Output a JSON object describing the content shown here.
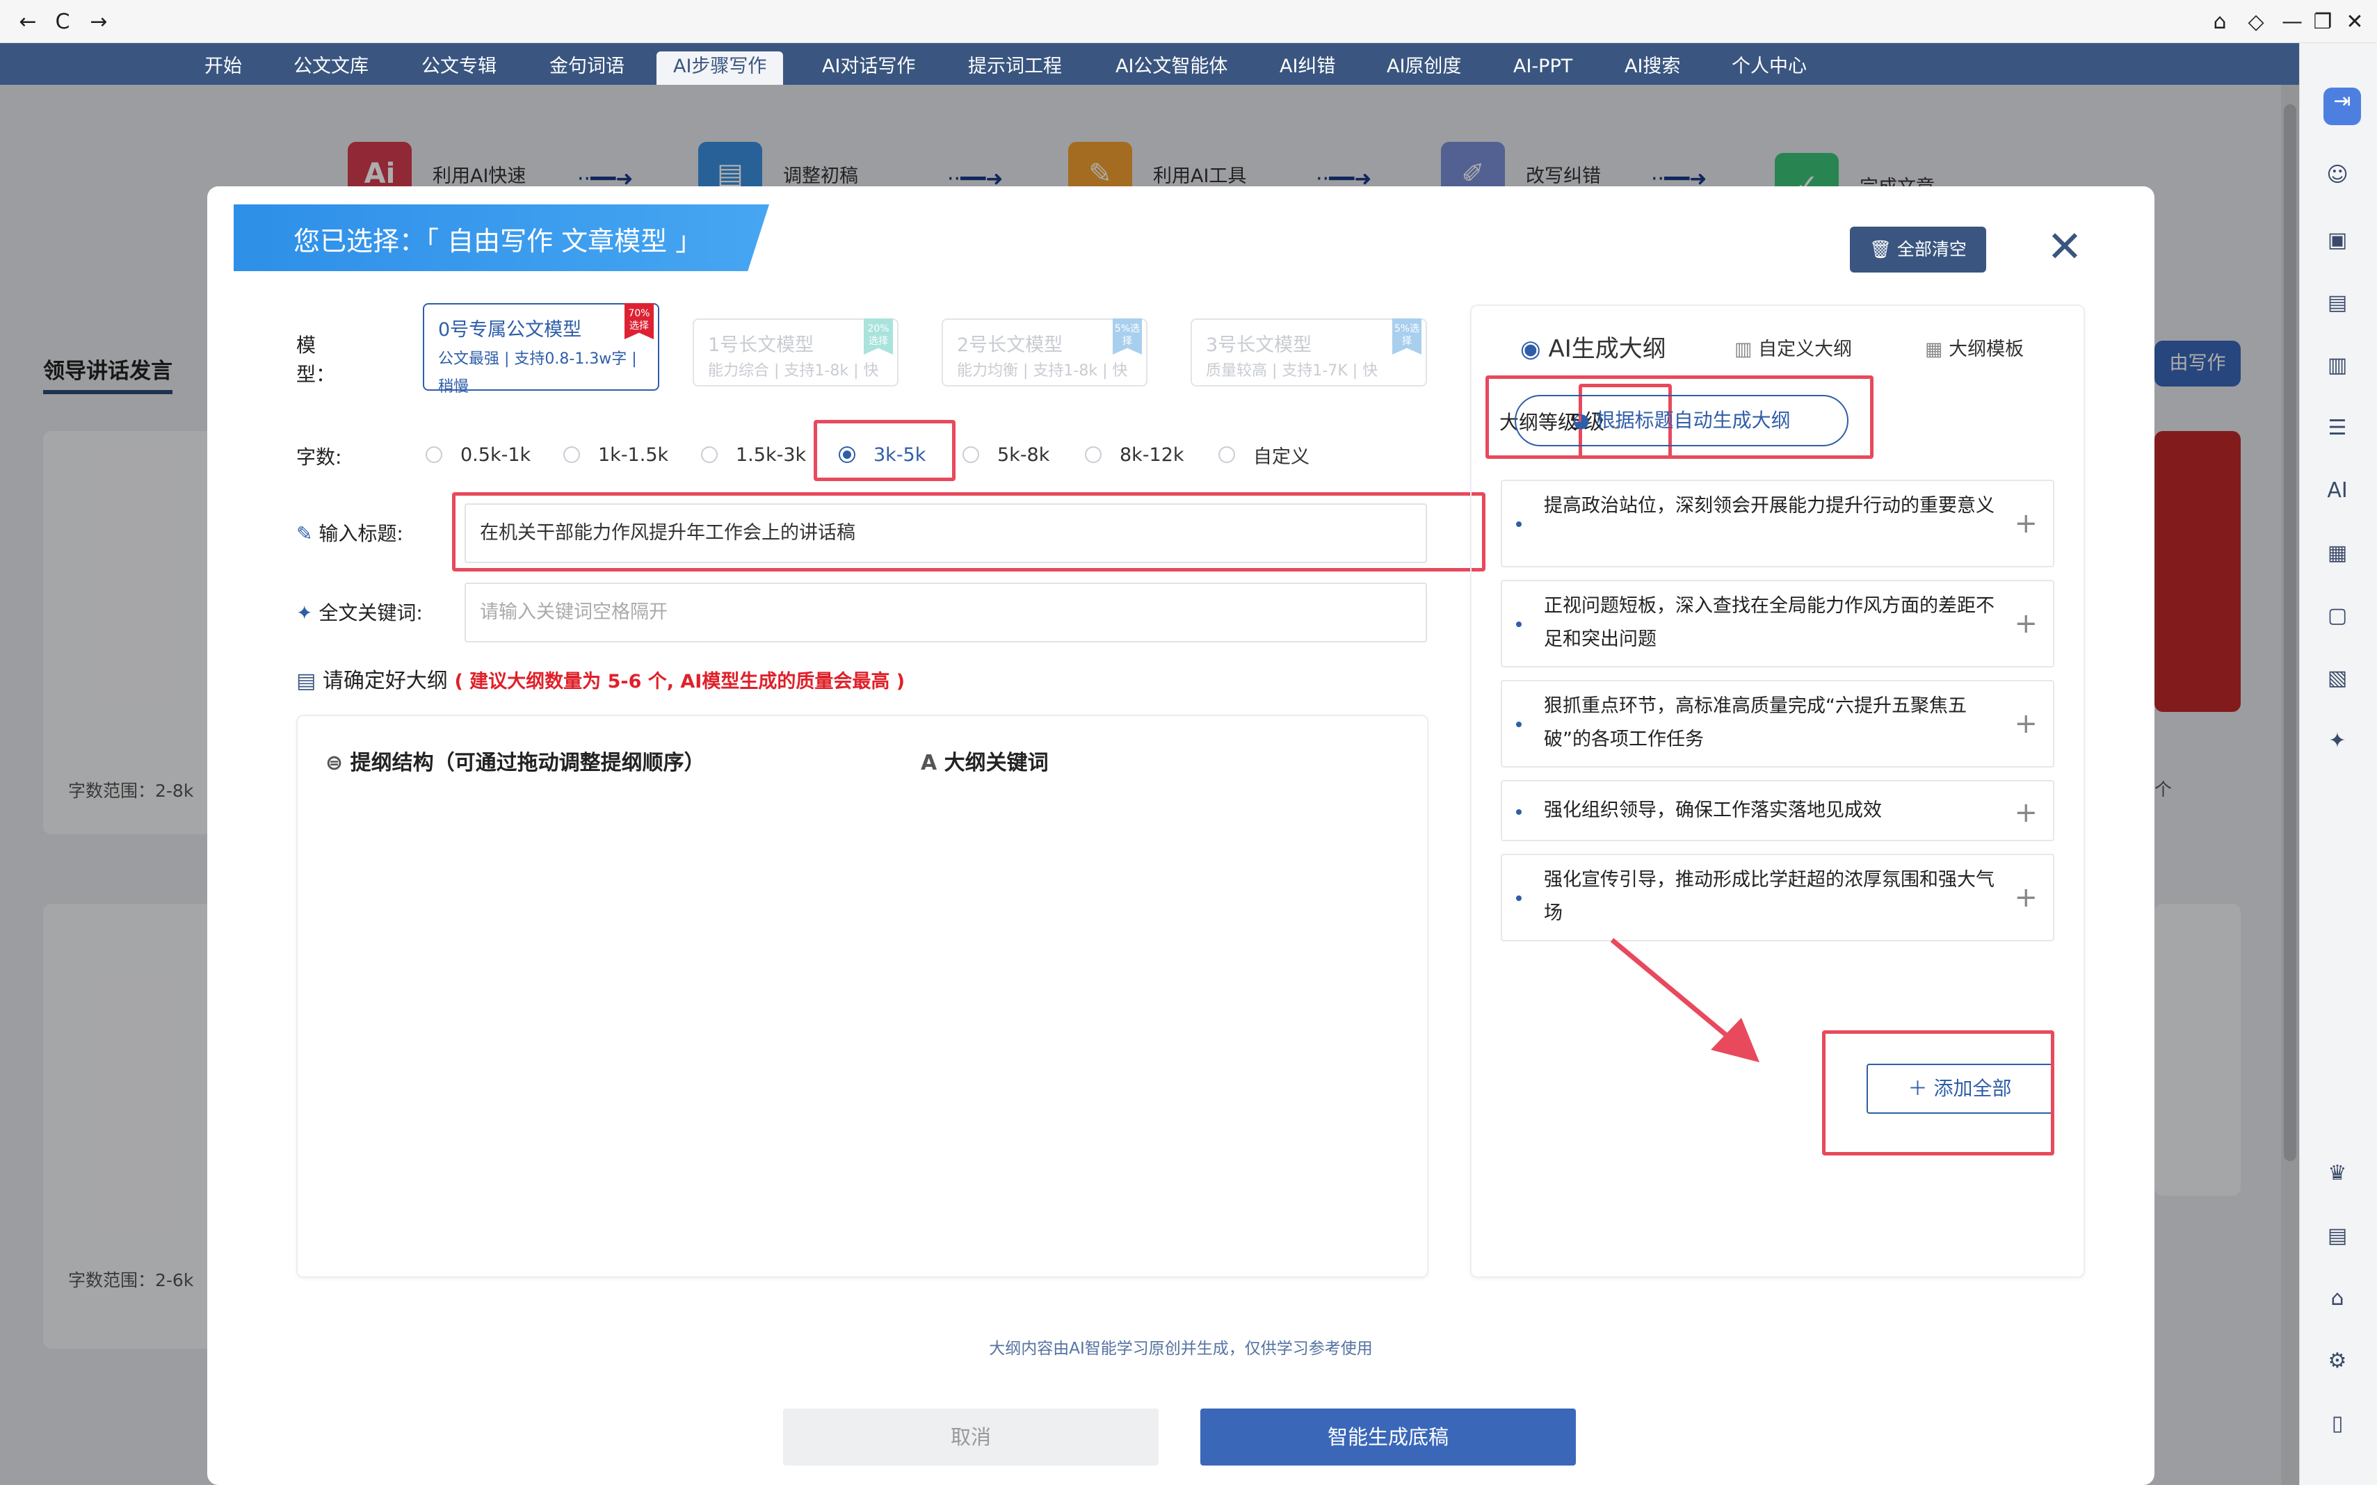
{
  "chrome": {
    "back": "←",
    "reload": "C",
    "forward": "→",
    "home": "⌂",
    "fav": "◇",
    "min": "—",
    "restore": "❐",
    "close": "✕"
  },
  "nav": [
    "开始",
    "公文文库",
    "公文专辑",
    "金句词语",
    "AI步骤写作",
    "AI对话写作",
    "提示词工程",
    "AI公文智能体",
    "AI纠错",
    "AI原创度",
    "AI-PPT",
    "AI搜索",
    "个人中心"
  ],
  "background": {
    "steps": [
      "利用AI快速",
      "调整初稿",
      "利用AI工具",
      "改写纠错",
      "完成文章"
    ],
    "tab": "领导讲话发言",
    "ranges": [
      "字数范围：2-8k",
      "字数范围：2-6k"
    ],
    "side_button": "由写作",
    "count_suffix": "个"
  },
  "modal": {
    "banner": "您已选择：「 自由写作 文章模型 」",
    "clear_all": "全部清空",
    "close": "✕",
    "model_label": "模　型：",
    "models": [
      {
        "name": "0号专属公文模型",
        "desc": "公文最强 | 支持0.8-1.3w字 | 稍慢",
        "badge": "70%选择"
      },
      {
        "name": "1号长文模型",
        "desc": "能力综合 | 支持1-8k | 快",
        "badge": "20%选择"
      },
      {
        "name": "2号长文模型",
        "desc": "能力均衡 | 支持1-8k | 快",
        "badge": "5%选择"
      },
      {
        "name": "3号长文模型",
        "desc": "质量较高 | 支持1-7K | 快",
        "badge": "5%选择"
      }
    ],
    "wordcount_label": "字数:",
    "wordcounts": [
      "0.5k-1k",
      "1k-1.5k",
      "1.5k-3k",
      "3k-5k",
      "5k-8k",
      "8k-12k",
      "自定义"
    ],
    "wordcount_selected": "3k-5k",
    "title_label": "输入标题:",
    "title_value": "在机关干部能力作风提升年工作会上的讲话稿",
    "keywords_label": "全文关键词:",
    "keywords_placeholder": "请输入关键词空格隔开",
    "confirm_outline": "请确定好大纲",
    "outline_hint": "( 建议大纲数量为 5-6 个, AI模型生成的质量会最高 )",
    "structure_title": "提纲结构（可通过拖动调整提纲顺序）",
    "outline_keywords_title": "大纲关键词",
    "right": {
      "tab_ai": "AI生成大纲",
      "tab_custom": "自定义大纲",
      "tab_template": "大纲模板",
      "level_label": "大纲等级",
      "level_value": "5级",
      "auto_generate": "根据标题自动生成大纲",
      "items": [
        "提高政治站位，深刻领会开展能力提升行动的重要意义",
        "正视问题短板，深入查找在全局能力作风方面的差距不足和突出问题",
        "狠抓重点环节，高标准高质量完成“六提升五聚焦五破”的各项工作任务",
        "强化组织领导，确保工作落实落地见成效",
        "强化宣传引导，推动形成比学赶超的浓厚氛围和强大气场"
      ],
      "add_all": "添加全部"
    },
    "disclaimer": "大纲内容由AI智能学习原创并生成，仅供学习参考使用",
    "cancel": "取消",
    "generate": "智能生成底稿"
  },
  "colors": {
    "nav": "#3a5680",
    "primary": "#2f5ea8",
    "highlight": "#e8495c",
    "banner": "#2e8fe8"
  }
}
